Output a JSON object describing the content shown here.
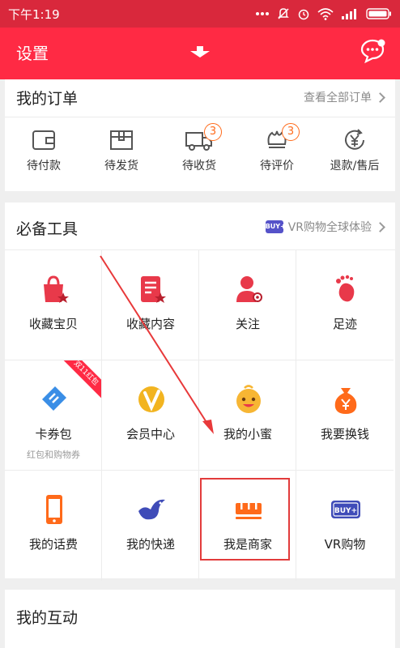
{
  "status_bar": {
    "time": "下午1:19",
    "icons": [
      "dots-icon",
      "mute-icon",
      "alarm-icon",
      "wifi-icon",
      "signal-icon",
      "battery-icon"
    ],
    "color": "#d9283c"
  },
  "header": {
    "settings_label": "设置",
    "color": "#ff2a44"
  },
  "orders": {
    "title": "我的订单",
    "view_all": "查看全部订单",
    "items": [
      {
        "label": "待付款",
        "icon": "wallet-icon",
        "badge": ""
      },
      {
        "label": "待发货",
        "icon": "package-icon",
        "badge": ""
      },
      {
        "label": "待收货",
        "icon": "truck-icon",
        "badge": "3"
      },
      {
        "label": "待评价",
        "icon": "review-icon",
        "badge": "3"
      },
      {
        "label": "退款/售后",
        "icon": "refund-icon",
        "badge": ""
      }
    ]
  },
  "tools": {
    "title": "必备工具",
    "vr_badge": "BUY+",
    "vr_link": "VR购物全球体验",
    "items": [
      {
        "label": "收藏宝贝",
        "sub": "",
        "icon": "favorite-bag-icon"
      },
      {
        "label": "收藏内容",
        "sub": "",
        "icon": "favorite-content-icon"
      },
      {
        "label": "关注",
        "sub": "",
        "icon": "follow-icon"
      },
      {
        "label": "足迹",
        "sub": "",
        "icon": "footprint-icon"
      },
      {
        "label": "卡券包",
        "sub": "红包和购物券",
        "icon": "coupon-icon",
        "ribbon": "双11红包"
      },
      {
        "label": "会员中心",
        "sub": "",
        "icon": "vip-icon"
      },
      {
        "label": "我的小蜜",
        "sub": "",
        "icon": "assistant-icon"
      },
      {
        "label": "我要换钱",
        "sub": "",
        "icon": "money-bag-icon"
      },
      {
        "label": "我的话费",
        "sub": "",
        "icon": "phone-icon"
      },
      {
        "label": "我的快递",
        "sub": "",
        "icon": "express-bird-icon"
      },
      {
        "label": "我是商家",
        "sub": "",
        "icon": "merchant-icon"
      },
      {
        "label": "VR购物",
        "sub": "",
        "icon": "vr-icon",
        "icon_text": "BUY+"
      }
    ]
  },
  "interact": {
    "title": "我的互动"
  },
  "colors": {
    "accent": "#ff2a44",
    "highlight_box": "#e23b3b",
    "annotation_arrow": "#e8393a",
    "badge": "#ff6a1a"
  }
}
